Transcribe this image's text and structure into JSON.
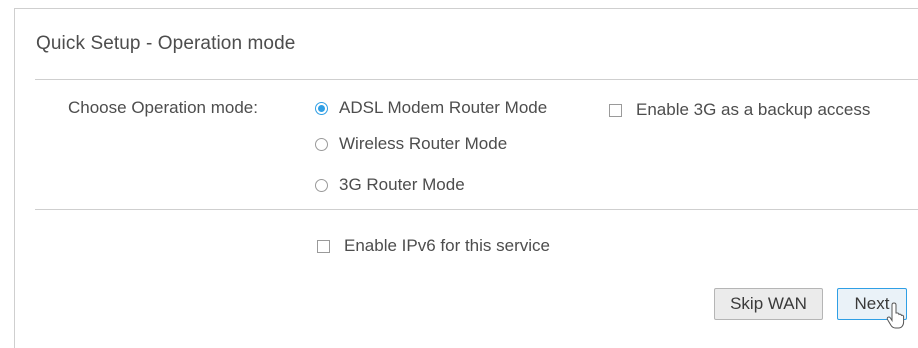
{
  "title": "Quick Setup - Operation mode",
  "operation": {
    "label": "Choose Operation mode:",
    "options": [
      {
        "label": "ADSL Modem Router Mode",
        "selected": true
      },
      {
        "label": "Wireless Router Mode",
        "selected": false
      },
      {
        "label": "3G Router Mode",
        "selected": false
      }
    ],
    "backup_3g_label": "Enable 3G as a backup access",
    "backup_3g_checked": false
  },
  "ipv6": {
    "label": "Enable IPv6 for this service",
    "checked": false
  },
  "buttons": {
    "skip_wan": "Skip WAN",
    "next": "Next"
  },
  "colors": {
    "accent": "#2f9fe5",
    "text": "#4d4d4d",
    "divider": "#cfcfcf"
  }
}
